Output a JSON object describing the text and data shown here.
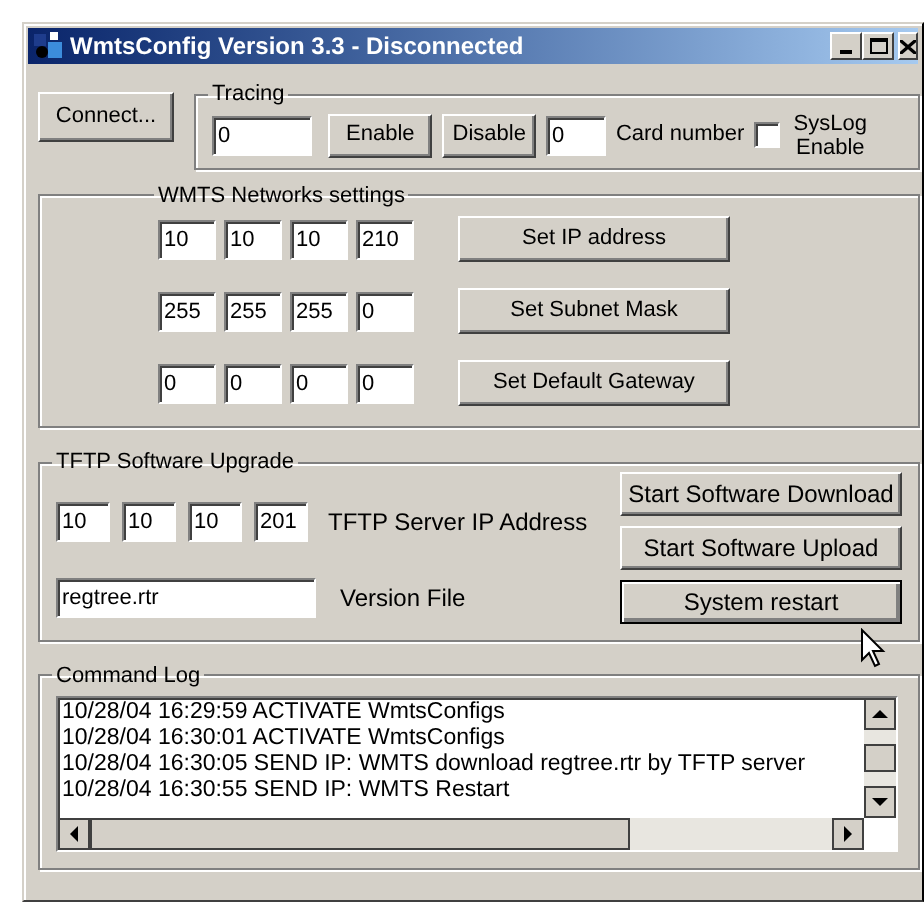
{
  "window": {
    "title": "WmtsConfig Version 3.3 - Disconnected"
  },
  "connect_button": "Connect...",
  "tracing": {
    "title": "Tracing",
    "value": "0",
    "enable_button": "Enable",
    "disable_button": "Disable",
    "card_number": "0",
    "card_number_label": "Card number",
    "syslog": {
      "label": "SysLog Enable",
      "checked": false
    }
  },
  "networks": {
    "title": "WMTS Networks settings",
    "rows": [
      {
        "octets": [
          "10",
          "10",
          "10",
          "210"
        ],
        "button": "Set IP address"
      },
      {
        "octets": [
          "255",
          "255",
          "255",
          "0"
        ],
        "button": "Set Subnet Mask"
      },
      {
        "octets": [
          "0",
          "0",
          "0",
          "0"
        ],
        "button": "Set Default Gateway"
      }
    ]
  },
  "tftp": {
    "title": "TFTP Software Upgrade",
    "octets": [
      "10",
      "10",
      "10",
      "201"
    ],
    "ip_label": "TFTP Server IP Address",
    "version_file": "regtree.rtr",
    "version_label": "Version File",
    "buttons": [
      {
        "label": "Start Software Download",
        "focused": false
      },
      {
        "label": "Start Software Upload",
        "focused": false
      },
      {
        "label": "System restart",
        "focused": true
      }
    ]
  },
  "command_log": {
    "title": "Command Log",
    "lines": [
      "10/28/04 16:29:59 ACTIVATE WmtsConfigs",
      "10/28/04 16:30:01 ACTIVATE WmtsConfigs",
      "10/28/04 16:30:05 SEND IP: WMTS download regtree.rtr by TFTP server",
      "10/28/04 16:30:55 SEND IP: WMTS Restart"
    ]
  }
}
